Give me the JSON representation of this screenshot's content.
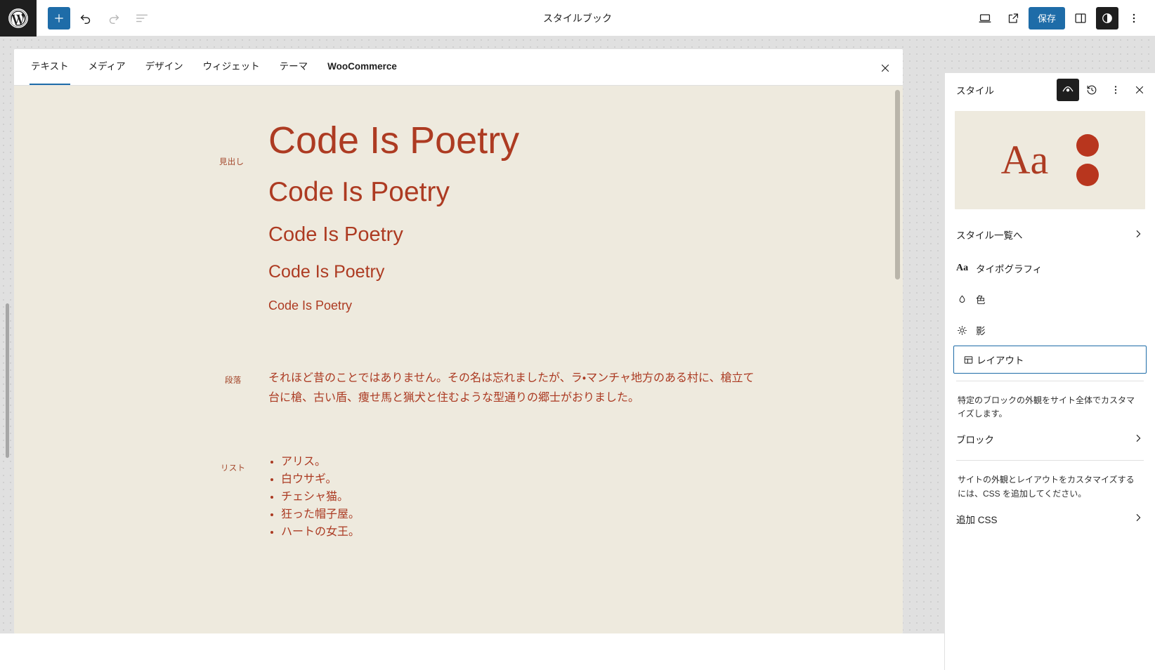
{
  "app": {
    "title": "スタイルブック",
    "logo_icon": "wordpress-logo-icon"
  },
  "toolbar": {
    "add_block_label": "+",
    "add_block_icon": "plus-icon",
    "undo_icon": "undo-icon",
    "redo_icon": "redo-icon",
    "list_view_icon": "list-view-icon",
    "device_preview_icon": "desktop-icon",
    "view_site_icon": "external-link-icon",
    "save_label": "保存",
    "sidebar_toggle_icon": "sidebar-panel-icon",
    "style_toggle_icon": "contrast-circle-icon",
    "more_options_icon": "kebab-menu-icon"
  },
  "stylebook": {
    "tabs": [
      {
        "label": "テキスト",
        "active": true
      },
      {
        "label": "メディア",
        "active": false
      },
      {
        "label": "デザイン",
        "active": false
      },
      {
        "label": "ウィジェット",
        "active": false
      },
      {
        "label": "テーマ",
        "active": false
      },
      {
        "label": "WooCommerce",
        "active": false
      }
    ],
    "close_icon": "close-icon",
    "sections": {
      "heading": {
        "label": "見出し",
        "samples": [
          "Code Is Poetry",
          "Code Is Poetry",
          "Code Is Poetry",
          "Code Is Poetry",
          "Code Is Poetry"
        ]
      },
      "paragraph": {
        "label": "段落",
        "text": "それほど昔のことではありません。その名は忘れましたが、ラ・マンチャ地方のある村に、槍立て台に槍、古い盾、痩せ馬と猟犬と住むような型通りの郷士がおりました。"
      },
      "list": {
        "label": "リスト",
        "items": [
          "アリス。",
          "白ウサギ。",
          "チェシャ猫。",
          "狂った帽子屋。",
          "ハートの女王。"
        ]
      }
    }
  },
  "sidebar": {
    "title": "スタイル",
    "actions": {
      "stylebook_icon": "eye-stylebook-icon",
      "revisions_icon": "history-clock-icon",
      "more_icon": "kebab-menu-icon",
      "close_icon": "close-icon"
    },
    "preview": {
      "letters": "Aa",
      "letters_color": "#ad3b22",
      "dot_color": "#b8361e",
      "background": "#eeeade"
    },
    "browse_styles": {
      "label": "スタイル一覧へ",
      "chevron_icon": "chevron-right-icon"
    },
    "menu": [
      {
        "label": "タイポグラフィ",
        "icon": "typography-aa-icon",
        "focused": false
      },
      {
        "label": "色",
        "icon": "color-droplet-icon",
        "focused": false
      },
      {
        "label": "影",
        "icon": "shadow-sun-icon",
        "focused": false
      },
      {
        "label": "レイアウト",
        "icon": "layout-icon",
        "focused": true
      }
    ],
    "blocks_help": "特定のブロックの外観をサイト全体でカスタマイズします。",
    "blocks_row": {
      "label": "ブロック",
      "chevron_icon": "chevron-right-icon"
    },
    "css_help": "サイトの外観とレイアウトをカスタマイズするには、CSS を追加してください。",
    "css_row": {
      "label": "追加 CSS",
      "chevron_icon": "chevron-right-icon"
    }
  },
  "theme": {
    "accent_blue": "#1e6ca8",
    "text_red": "#ad3b22",
    "canvas_bg": "#eeeade"
  }
}
